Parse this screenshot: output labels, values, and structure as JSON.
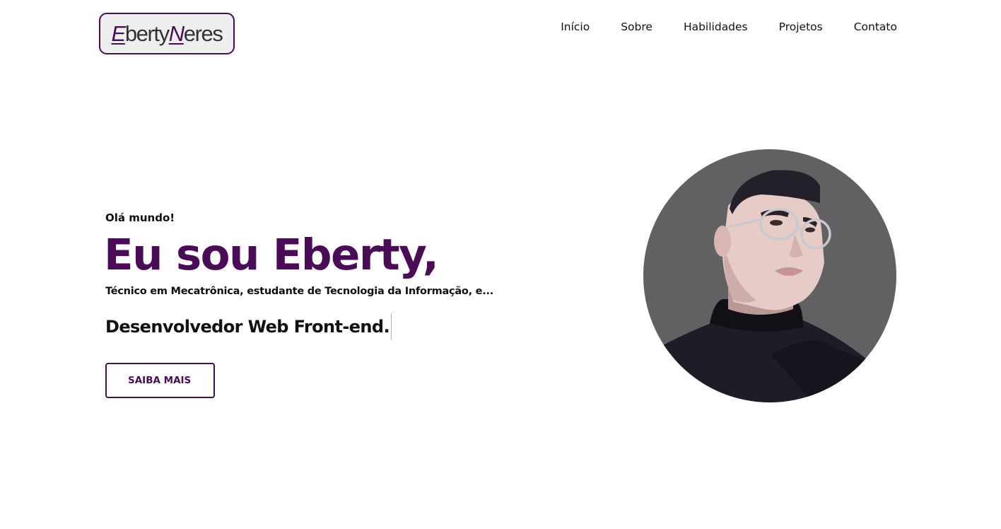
{
  "header": {
    "logo": {
      "first_initial": "E",
      "first_rest": "berty",
      "last_initial": "N",
      "last_rest": "eres"
    },
    "nav": {
      "items": [
        {
          "label": "Início"
        },
        {
          "label": "Sobre"
        },
        {
          "label": "Habilidades"
        },
        {
          "label": "Projetos"
        },
        {
          "label": "Contato"
        }
      ]
    }
  },
  "hero": {
    "greeting": "Olá mundo!",
    "title": "Eu sou Eberty,",
    "subtitle": "Técnico em Mecatrônica, estudante de Tecnologia da Informação, e...",
    "role": "Desenvolvedor Web Front-end.",
    "cta_label": "SAIBA MAIS"
  },
  "avatar": {
    "icon": "illustrated-portrait"
  },
  "colors": {
    "accent": "#4b0c57",
    "text": "#111111",
    "logo_background": "#eeeeef",
    "avatar_background": "#616163",
    "background": "#ffffff"
  }
}
